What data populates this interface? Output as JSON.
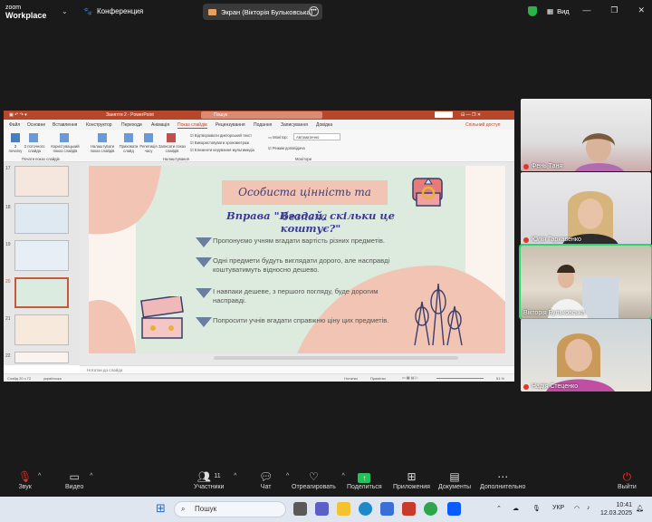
{
  "app": {
    "logo_line1": "zoom",
    "logo_line2": "Workplace",
    "conference_label": "Конференция",
    "share_label": "Экран (Вікторія Бульковська)",
    "view_label": "Вид"
  },
  "powerpoint": {
    "window_title": "Заняття 2 - PowerPoint",
    "search_placeholder": "Пошук",
    "tabs": [
      "Файл",
      "Основне",
      "Вставлення",
      "Конструктор",
      "Переходи",
      "Анімація",
      "Показ слайдів",
      "Рецензування",
      "Подання",
      "Записування",
      "Довідка"
    ],
    "active_tab": "Показ слайдів",
    "share_button": "Спільний доступ",
    "ribbon": {
      "btn_from_start": "З початку",
      "btn_from_current": "З поточного слайда",
      "btn_custom": "Користувацький показ слайдів",
      "group1": "Почати показ слайдів",
      "btn_setup": "Налаштувати показ слайдів",
      "btn_hide": "Приховати слайд",
      "btn_rehearse": "Репетиція часу",
      "btn_record": "Записати показ слайдів",
      "chk_narrations": "Відтворювати дикторський текст",
      "chk_timings": "Використовувати хронометраж",
      "chk_media": "Елементи керування мультимедіа",
      "group2": "Налаштування",
      "monitor_label": "Монітор:",
      "monitor_value": "Автоматично",
      "chk_presenter": "Режим доповідача",
      "group3": "Монітори"
    },
    "thumb_numbers": [
      "17",
      "18",
      "19",
      "20",
      "21",
      "22"
    ],
    "slide": {
      "title": "Особиста цінність та безпека",
      "subtitle": "Вправа \"Вгадай, скільки це коштує?\"",
      "bullets": [
        "Пропонуємо учням вгадати вартість різних предметів.",
        "Одні предмети будуть виглядати дорого, але насправді коштуватимуть відносно дешево.",
        "І навпаки дешеве, з першого погляду, буде дорогим насправді.",
        "Попросити учнів вгадати справжню ціну цих предметів."
      ]
    },
    "notes_placeholder": "Нотатки до слайда",
    "status_left": "Слайд 20 з 72",
    "status_lang": "українська",
    "status_notes": "Нотатки",
    "status_comments": "Примітки",
    "zoom": "51 %"
  },
  "participants": [
    {
      "name": "Фень Таня"
    },
    {
      "name": "Юлія Гаркавенко"
    },
    {
      "name": "Вікторія Бульковська"
    },
    {
      "name": "Надія Стеценко"
    }
  ],
  "toolbar": {
    "audio": "Звук",
    "video": "Видео",
    "participants": "Участники",
    "participants_count": "11",
    "chat": "Чат",
    "react": "Отреагировать",
    "share": "Поделиться",
    "apps": "Приложения",
    "docs": "Документы",
    "more": "Дополнительно",
    "leave": "Выйти"
  },
  "taskbar": {
    "search_placeholder": "Пошук",
    "lang": "УКР",
    "time": "10:41",
    "date": "12.03.2025"
  },
  "colors": {
    "accent_green": "#2bd66a",
    "pp_red": "#b7472a",
    "zoom_share_green": "#24c05a"
  }
}
